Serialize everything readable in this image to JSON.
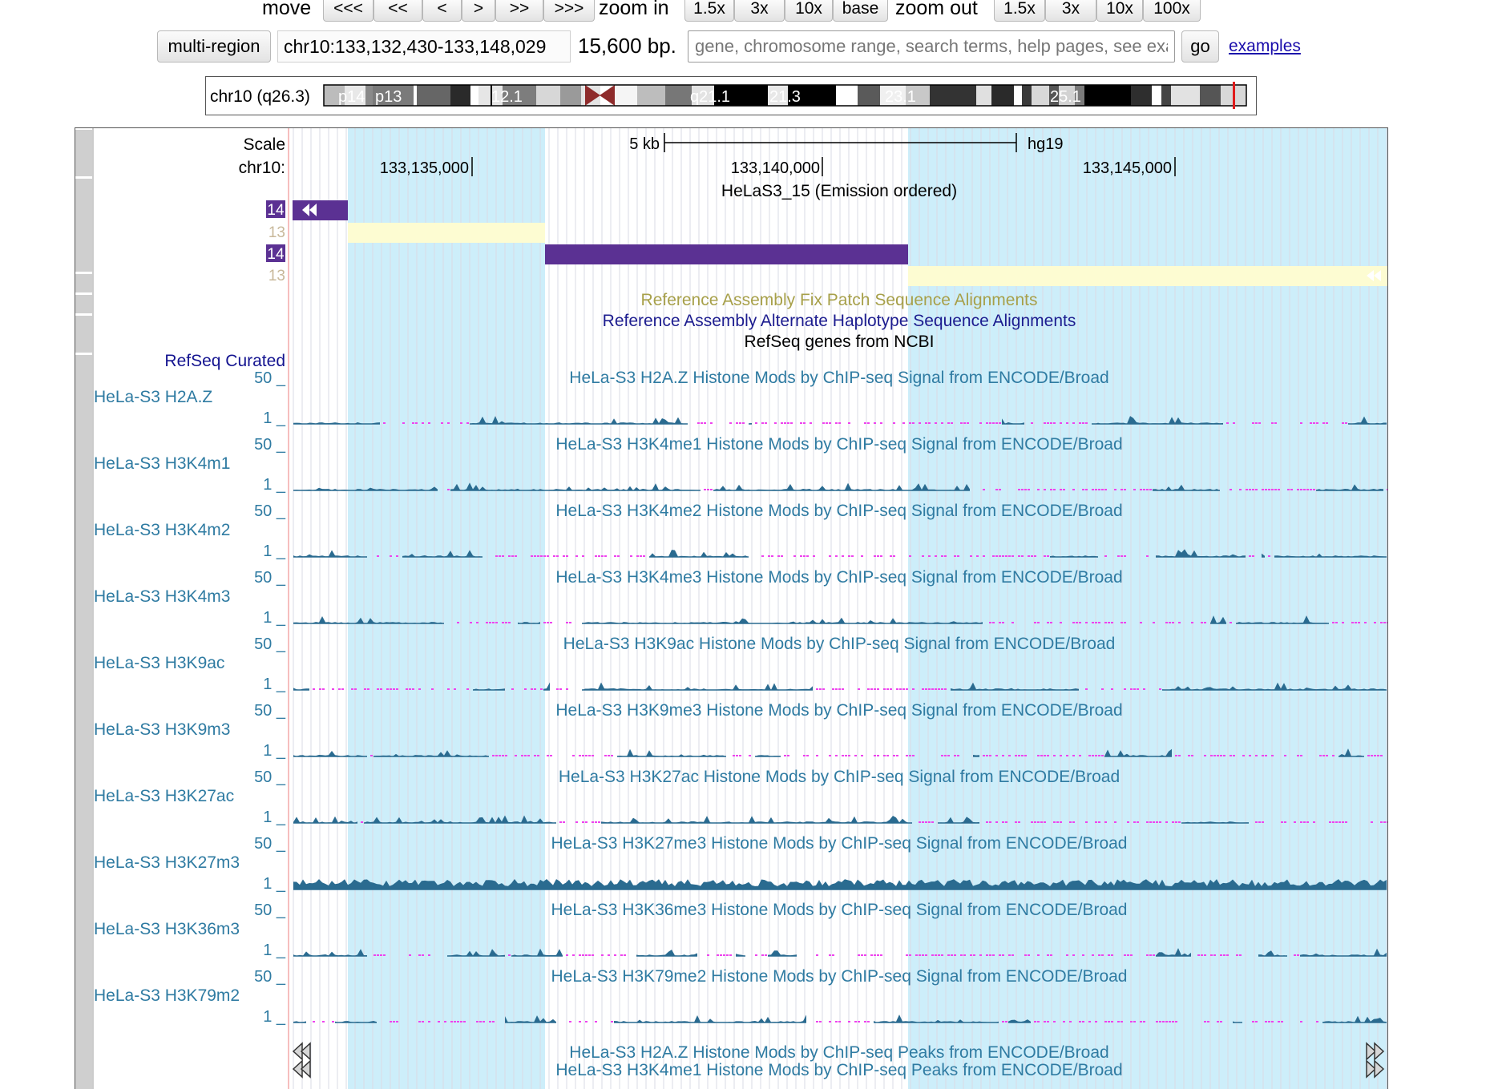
{
  "nav": {
    "move_label": "move",
    "move_buttons": [
      "<<<",
      "<<",
      "<",
      ">",
      ">>",
      ">>>"
    ],
    "zoom_in_label": "zoom in",
    "zoom_in_buttons": [
      "1.5x",
      "3x",
      "10x",
      "base"
    ],
    "zoom_out_label": "zoom out",
    "zoom_out_buttons": [
      "1.5x",
      "3x",
      "10x",
      "100x"
    ]
  },
  "position_bar": {
    "multi_region_label": "multi-region",
    "position": "chr10:133,132,430-133,148,029",
    "size": "15,600 bp.",
    "search_placeholder": "gene, chromosome range, search terms, help pages, see examples",
    "go_label": "go",
    "examples_label": "examples"
  },
  "ideogram": {
    "label": "chr10 (q26.3)",
    "band_labels": [
      "p14",
      "p13",
      "12.1",
      "q21.1",
      "21.3",
      "23.1",
      "25.1"
    ]
  },
  "browser": {
    "scale_label": "Scale",
    "chrom_label": "chr10:",
    "scale_bar_label": "5 kb",
    "assembly": "hg19",
    "coords": [
      "133,135,000",
      "133,140,000",
      "133,145,000"
    ],
    "chromhmm_title": "HeLaS3_15 (Emission ordered)",
    "state_labels": [
      "14",
      "13",
      "14",
      "13"
    ],
    "fix_patch_title": "Reference Assembly Fix Patch Sequence Alignments",
    "alt_haplo_title": "Reference Assembly Alternate Haplotype Sequence Alignments",
    "refseq_title": "RefSeq genes from NCBI",
    "refseq_curated": "RefSeq Curated",
    "signal_tracks": [
      {
        "name": "HeLa-S3 H2A.Z",
        "title": "HeLa-S3 H2A.Z Histone Mods by ChIP-seq Signal from ENCODE/Broad",
        "max": "50 _",
        "min": "1 _"
      },
      {
        "name": "HeLa-S3 H3K4m1",
        "title": "HeLa-S3 H3K4me1 Histone Mods by ChIP-seq Signal from ENCODE/Broad",
        "max": "50 _",
        "min": "1 _"
      },
      {
        "name": "HeLa-S3 H3K4m2",
        "title": "HeLa-S3 H3K4me2 Histone Mods by ChIP-seq Signal from ENCODE/Broad",
        "max": "50 _",
        "min": "1 _"
      },
      {
        "name": "HeLa-S3 H3K4m3",
        "title": "HeLa-S3 H3K4me3 Histone Mods by ChIP-seq Signal from ENCODE/Broad",
        "max": "50 _",
        "min": "1 _"
      },
      {
        "name": "HeLa-S3 H3K9ac",
        "title": "HeLa-S3 H3K9ac Histone Mods by ChIP-seq Signal from ENCODE/Broad",
        "max": "50 _",
        "min": "1 _"
      },
      {
        "name": "HeLa-S3 H3K9m3",
        "title": "HeLa-S3 H3K9me3 Histone Mods by ChIP-seq Signal from ENCODE/Broad",
        "max": "50 _",
        "min": "1 _"
      },
      {
        "name": "HeLa-S3 H3K27ac",
        "title": "HeLa-S3 H3K27ac Histone Mods by ChIP-seq Signal from ENCODE/Broad",
        "max": "50 _",
        "min": "1 _"
      },
      {
        "name": "HeLa-S3 H3K27m3",
        "title": "HeLa-S3 H3K27me3 Histone Mods by ChIP-seq Signal from ENCODE/Broad",
        "max": "50 _",
        "min": "1 _"
      },
      {
        "name": "HeLa-S3 H3K36m3",
        "title": "HeLa-S3 H3K36me3 Histone Mods by ChIP-seq Signal from ENCODE/Broad",
        "max": "50 _",
        "min": "1 _"
      },
      {
        "name": "HeLa-S3 H3K79m2",
        "title": "HeLa-S3 H3K79me2 Histone Mods by ChIP-seq Signal from ENCODE/Broad",
        "max": "50 _",
        "min": "1 _"
      }
    ],
    "peak_titles": [
      "HeLa-S3 H2A.Z Histone Mods by ChIP-seq Peaks from ENCODE/Broad",
      "HeLa-S3 H3K4me1 Histone Mods by ChIP-seq Peaks from ENCODE/Broad"
    ]
  },
  "colors": {
    "highlight": "#cdeefa",
    "state14": "#5b3193",
    "state13": "#fdfcd2",
    "track_label": "#2f7ba2",
    "signal": "#2a6b90",
    "missing": "#ee44ee",
    "fix_patch": "#a7a04a",
    "alt_haplo": "#1c1c8f",
    "refseq": "#141490",
    "cytoband_marker": "#e01b1b"
  }
}
